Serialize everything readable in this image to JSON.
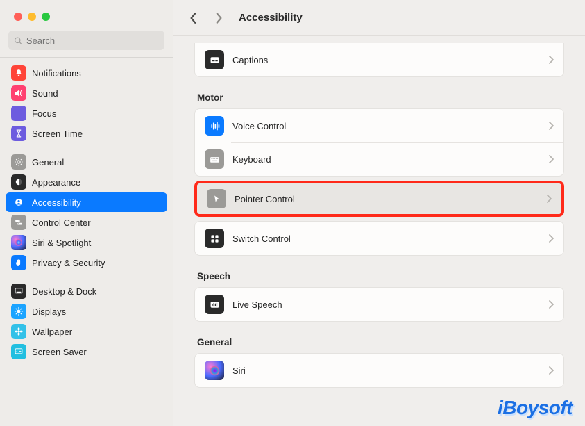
{
  "title": "Accessibility",
  "search": {
    "placeholder": "Search"
  },
  "sidebar": {
    "group1": [
      {
        "label": "Notifications",
        "icon": "bell",
        "bg": "#ff4438"
      },
      {
        "label": "Sound",
        "icon": "sound",
        "bg": "#ff4070"
      },
      {
        "label": "Focus",
        "icon": "moon",
        "bg": "#6d5cdf"
      },
      {
        "label": "Screen Time",
        "icon": "hourglass",
        "bg": "#6d5cdf"
      }
    ],
    "group2": [
      {
        "label": "General",
        "icon": "gear",
        "bg": "#9b9a97"
      },
      {
        "label": "Appearance",
        "icon": "appearance",
        "bg": "#2a2a2a"
      },
      {
        "label": "Accessibility",
        "icon": "person",
        "bg": "#0a7aff",
        "selected": true
      },
      {
        "label": "Control Center",
        "icon": "switches",
        "bg": "#9b9a97"
      },
      {
        "label": "Siri & Spotlight",
        "icon": "siri",
        "bg": "grad-siri"
      },
      {
        "label": "Privacy & Security",
        "icon": "hand",
        "bg": "#0a7aff"
      }
    ],
    "group3": [
      {
        "label": "Desktop & Dock",
        "icon": "dock",
        "bg": "#2a2a2a"
      },
      {
        "label": "Displays",
        "icon": "sun",
        "bg": "#1ca4ff"
      },
      {
        "label": "Wallpaper",
        "icon": "flower",
        "bg": "#33c1e8"
      },
      {
        "label": "Screen Saver",
        "icon": "screensaver",
        "bg": "#22bfe0"
      }
    ]
  },
  "content": {
    "topRow": {
      "label": "Captions",
      "icon": "captions",
      "bg": "#2a2a2a"
    },
    "sections": [
      {
        "header": "Motor",
        "rows": [
          {
            "label": "Voice Control",
            "icon": "voice",
            "bg": "#0a7aff"
          },
          {
            "label": "Keyboard",
            "icon": "keyboard",
            "bg": "#9b9a97"
          },
          {
            "label": "Pointer Control",
            "icon": "pointer",
            "bg": "#9b9a97",
            "highlighted": true
          },
          {
            "label": "Switch Control",
            "icon": "grid",
            "bg": "#2a2a2a"
          }
        ]
      },
      {
        "header": "Speech",
        "rows": [
          {
            "label": "Live Speech",
            "icon": "livespeech",
            "bg": "#2a2a2a"
          }
        ]
      },
      {
        "header": "General",
        "rows": [
          {
            "label": "Siri",
            "icon": "siri-round",
            "bg": "grad-siri"
          }
        ]
      }
    ]
  },
  "watermark": "iBoysoft"
}
